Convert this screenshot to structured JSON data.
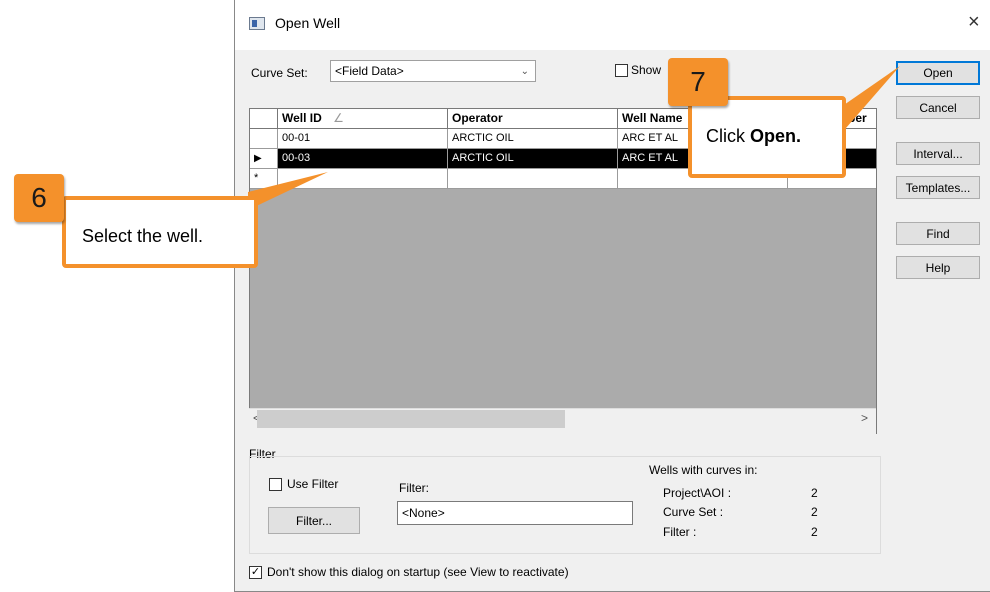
{
  "dialog": {
    "title": "Open Well",
    "close_glyph": "×",
    "curve_set_label": "Curve Set:",
    "curve_set_value": "<Field Data>",
    "show_label": "Show"
  },
  "buttons": {
    "open": "Open",
    "cancel": "Cancel",
    "interval": "Interval...",
    "templates": "Templates...",
    "find": "Find",
    "help": "Help"
  },
  "grid": {
    "columns": [
      "Well ID",
      "Operator",
      "Well Name",
      "ber"
    ],
    "rows": [
      {
        "well_id": "00-01",
        "operator": "ARCTIC OIL",
        "well_name": "ARC ET AL"
      },
      {
        "well_id": "00-03",
        "operator": "ARCTIC OIL",
        "well_name": "ARC ET AL"
      }
    ],
    "new_row_marker": "*",
    "selected_marker": "▶",
    "scroll_left": "<",
    "scroll_right": ">"
  },
  "filter": {
    "group_label": "Filter",
    "use_filter_label": "Use Filter",
    "filter_button": "Filter...",
    "filter_field_label": "Filter:",
    "filter_field_value": "<None>",
    "wells_with_curves_label": "Wells with curves in:",
    "stats": [
      {
        "label": "Project\\AOI :",
        "value": "2"
      },
      {
        "label": "Curve Set :",
        "value": "2"
      },
      {
        "label": "Filter :",
        "value": "2"
      }
    ]
  },
  "startup_checkbox": {
    "checked": true,
    "label": "Don't show this dialog on startup (see View to reactivate)"
  },
  "callouts": {
    "step6": {
      "number": "6",
      "text": "Select the well."
    },
    "step7": {
      "number": "7",
      "text_prefix": "Click ",
      "text_bold": "Open."
    }
  },
  "colors": {
    "accent": "#f4912b",
    "default_button_border": "#0078d7",
    "selection": "#000000"
  }
}
